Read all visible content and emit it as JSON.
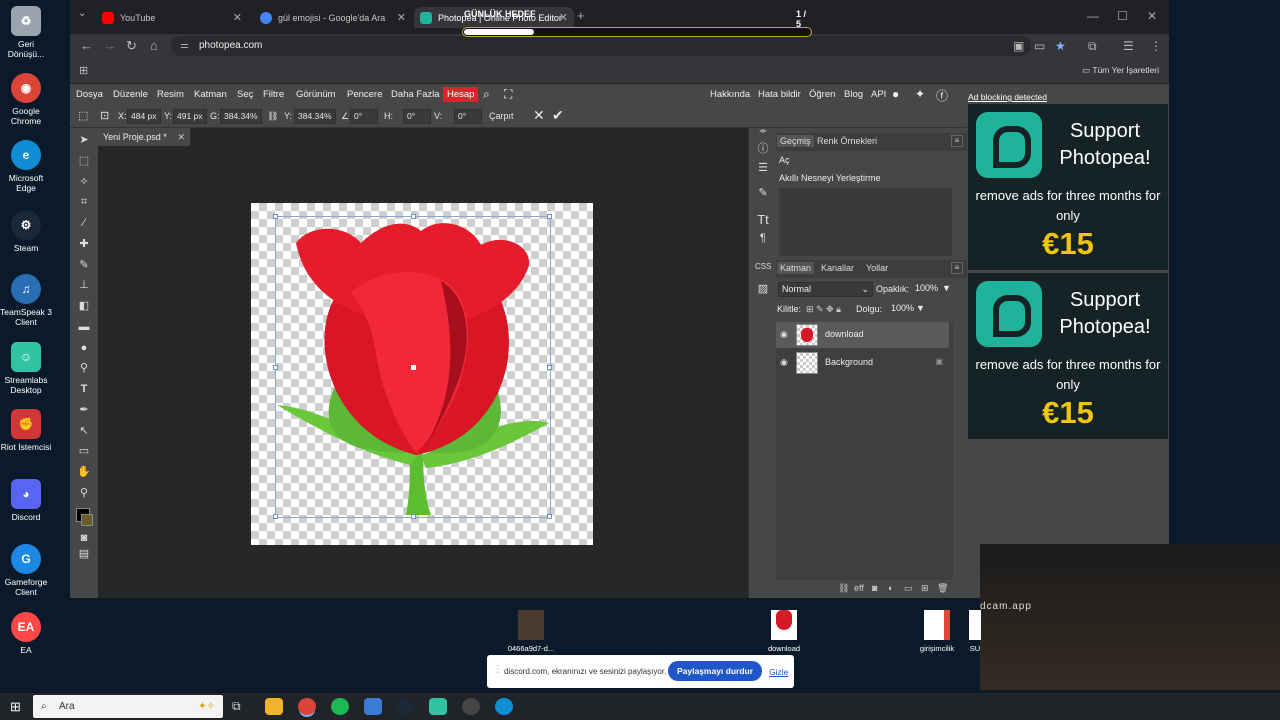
{
  "desktop": {
    "icons": [
      {
        "label": "Geri Dönüşü...",
        "color": "#9aa4ae"
      },
      {
        "label": "Google Chrome",
        "color": "#db4437"
      },
      {
        "label": "Microsoft Edge",
        "color": "#0f8ed6"
      },
      {
        "label": "Steam",
        "color": "#1b2838"
      },
      {
        "label": "TeamSpeak 3 Client",
        "color": "#2a6fb6"
      },
      {
        "label": "Streamlabs Desktop",
        "color": "#31c3a2"
      },
      {
        "label": "Riot İstemcisi",
        "color": "#d13639"
      },
      {
        "label": "Discord",
        "color": "#5865f2"
      },
      {
        "label": "Gameforge Client",
        "color": "#1e88e5"
      },
      {
        "label": "EA",
        "color": "#ff4747"
      }
    ],
    "files": [
      {
        "label": "0466a9d7-d...",
        "color": "#4a3a2e"
      },
      {
        "label": "download",
        "color": "#d41a24"
      },
      {
        "label": "girişimcilik",
        "color": "#d84a3a"
      },
      {
        "label": "SU",
        "color": "#ffffff"
      }
    ]
  },
  "browser": {
    "tabs": [
      {
        "title": "YouTube",
        "color": "#ff0000"
      },
      {
        "title": "gül emojisi - Google'da Ara",
        "color": "#4285f4"
      },
      {
        "title": "Photopea | Online Photo Editor",
        "color": "#20b39b"
      }
    ],
    "url": "photopea.com",
    "all_bookmarks": "Tüm Yer İşaretleri"
  },
  "photopea": {
    "menu": [
      "Dosya",
      "Düzenle",
      "Resim",
      "Katman",
      "Seç",
      "Filtre",
      "Görünüm",
      "Pencere",
      "Daha Fazla",
      "Hesap"
    ],
    "links": [
      "Hakkında",
      "Hata bildir",
      "Öğren",
      "Blog",
      "API"
    ],
    "options": {
      "x_label": "X:",
      "x": "484 px",
      "y_label": "Y:",
      "y": "491 px",
      "w_label": "G:",
      "w": "384.34%",
      "h_label": "Y:",
      "h": "384.34%",
      "angle_label": "∠:",
      "angle": "0°",
      "hskew_label": "H:",
      "hskew": "0°",
      "vskew_label": "V:",
      "vskew": "0°",
      "interp": "Çarpıt"
    },
    "document_tab": "Yeni Proje.psd *",
    "history": {
      "tabs": [
        "Geçmiş",
        "Renk Örnekleri"
      ],
      "items": [
        "Aç",
        "Akıllı Nesneyi Yerleştirme"
      ]
    },
    "layers": {
      "tabs": [
        "Katman",
        "Kanallar",
        "Yollar"
      ],
      "blend_mode": "Normal",
      "opacity_label": "Opaklık:",
      "opacity": "100%",
      "lock_label": "Kilitle:",
      "fill_label": "Dolgu:",
      "fill": "100%",
      "items": [
        {
          "name": "download"
        },
        {
          "name": "Background"
        }
      ]
    },
    "ads": {
      "label": "Ad blocking detected",
      "headline": "Support Photopea!",
      "body": "remove ads for three months for only",
      "price": "€15"
    }
  },
  "overlay": {
    "goal_title": "GÜNLÜK HEDEF",
    "goal_count": "1 / 5",
    "goal_progress": 0.2,
    "webcam_label": "dcam.app",
    "share_message": "discord.com, ekranınızı ve sesinizi paylaşıyor.",
    "share_stop": "Paylaşmayı durdur",
    "share_hide": "Gizle"
  },
  "taskbar": {
    "search_placeholder": "Ara",
    "apps": [
      {
        "name": "file-explorer",
        "color": "#f0b429"
      },
      {
        "name": "chrome",
        "color": "#db4437"
      },
      {
        "name": "spotify",
        "color": "#1db954"
      },
      {
        "name": "app",
        "color": "#3a7bd5"
      },
      {
        "name": "steam",
        "color": "#1b2838"
      },
      {
        "name": "streamlabs",
        "color": "#31c3a2"
      },
      {
        "name": "obs",
        "color": "#444444"
      },
      {
        "name": "edge",
        "color": "#0f8ed6"
      }
    ]
  }
}
